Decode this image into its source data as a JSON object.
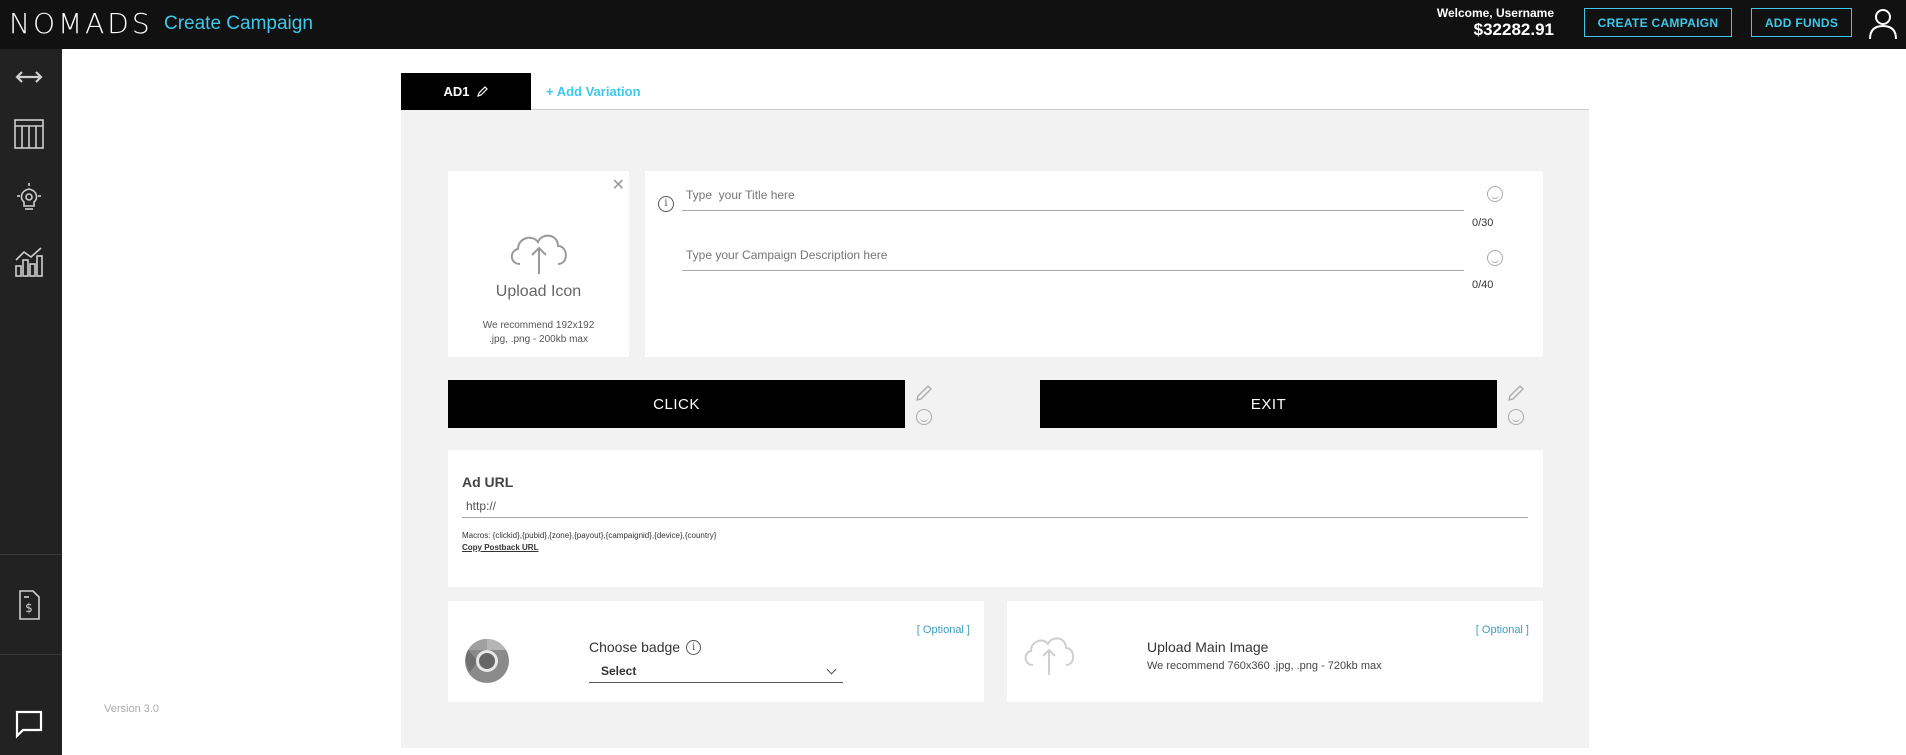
{
  "header": {
    "logo": "NOMADS",
    "page_title": "Create Campaign",
    "welcome": "Welcome, Username",
    "balance": "$32282.91",
    "create_campaign_label": "CREATE CAMPAIGN",
    "add_funds_label": "ADD FUNDS",
    "accent_color": "#3fc8ea"
  },
  "sidebar": {
    "icons": [
      "expand-arrows-icon",
      "table-grid-icon",
      "lightbulb-gear-icon",
      "analytics-chart-icon",
      "invoice-dollar-icon",
      "chat-bubble-icon"
    ],
    "version": "Version 3.0"
  },
  "tabs": {
    "active": "AD1",
    "add_variation": "+ Add Variation"
  },
  "upload_icon": {
    "label": "Upload Icon",
    "rec_line1": "We recommend 192x192",
    "rec_line2": ".jpg, .png - 200kb max"
  },
  "title_field": {
    "placeholder": "Type  your Title here",
    "counter": "0/30"
  },
  "description_field": {
    "placeholder": "Type your Campaign Description here",
    "counter": "0/40"
  },
  "buttons": {
    "click_label": "CLICK",
    "exit_label": "EXIT"
  },
  "ad_url": {
    "label": "Ad URL",
    "value": "http://",
    "macros": "Macros: {clickid},{pubid},{zone},{payout},{campaignid},{device},{country}",
    "postback": "Copy Postback URL"
  },
  "badge": {
    "optional": "[ Optional ]",
    "label": "Choose badge",
    "select_value": "Select"
  },
  "main_image": {
    "optional": "[ Optional ]",
    "label": "Upload Main Image",
    "rec": "We recommend 760x360 .jpg, .png - 720kb max"
  }
}
